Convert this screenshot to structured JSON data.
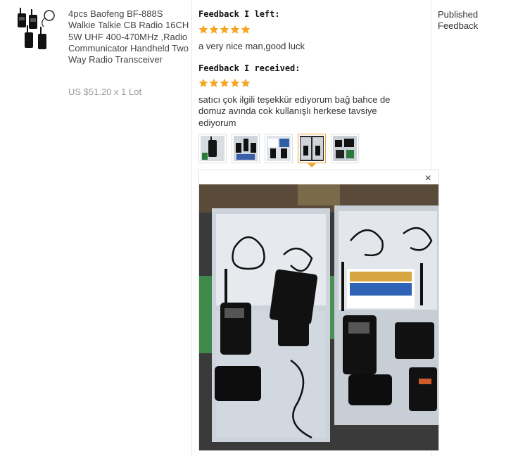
{
  "product": {
    "thumb_icon": "walkie-talkie-set-image",
    "title": "4pcs Baofeng BF-888S Walkie Talkie CB Radio 16CH 5W UHF 400-470MHz ,Radio Communicator Handheld Two Way Radio Transceiver",
    "price": "US $51.20 x 1 Lot"
  },
  "feedback_left": {
    "heading": "Feedback I left:",
    "rating": 5,
    "text": "a very nice man,good luck"
  },
  "feedback_received": {
    "heading": "Feedback I received:",
    "rating": 5,
    "text": "satıcı çok ilgili teşekkür ediyorum bağ bahce de domuz avında cok kullanışlı herkese tavsiye ediyorum"
  },
  "photos": {
    "count": 5,
    "active_index": 3,
    "close_icon": "×"
  },
  "status": {
    "label": "Published Feedback"
  },
  "colors": {
    "star": "#f5a623",
    "active_border": "#f0a53a",
    "divider": "#e8e8e8"
  }
}
